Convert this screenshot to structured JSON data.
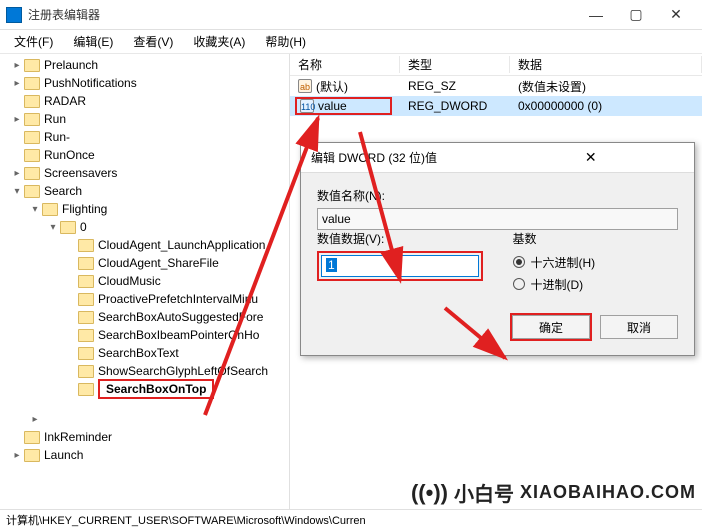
{
  "window": {
    "title": "注册表编辑器",
    "minimize": "—",
    "maximize": "▢",
    "close": "✕"
  },
  "menu": {
    "file": "文件(F)",
    "edit": "编辑(E)",
    "view": "查看(V)",
    "favorites": "收藏夹(A)",
    "help": "帮助(H)"
  },
  "tree": {
    "items": [
      "Prelaunch",
      "PushNotifications",
      "RADAR",
      "Run",
      "Run-",
      "RunOnce",
      "Screensavers",
      "Search",
      "Flighting",
      "0",
      "CloudAgent_LaunchApplication",
      "CloudAgent_ShareFile",
      "CloudMusic",
      "ProactivePrefetchIntervalMinu",
      "SearchBoxAutoSuggestedFore",
      "SearchBoxIbeamPointerOnHo",
      "SearchBoxText",
      "ShowSearchGlyphLeftOfSearch",
      "SearchBoxOnTop",
      "InkReminder",
      "Launch"
    ]
  },
  "list": {
    "col_name": "名称",
    "col_type": "类型",
    "col_data": "数据",
    "rows": [
      {
        "icon": "str",
        "name": "(默认)",
        "type": "REG_SZ",
        "data": "(数值未设置)"
      },
      {
        "icon": "bin",
        "name": "value",
        "type": "REG_DWORD",
        "data": "0x00000000 (0)"
      }
    ]
  },
  "dialog": {
    "title": "编辑 DWORD (32 位)值",
    "name_label": "数值名称(N):",
    "name_value": "value",
    "data_label": "数值数据(V):",
    "data_value": "1",
    "base_label": "基数",
    "radio_hex": "十六进制(H)",
    "radio_dec": "十进制(D)",
    "ok": "确定",
    "cancel": "取消",
    "close": "✕"
  },
  "statusbar": "计算机\\HKEY_CURRENT_USER\\SOFTWARE\\Microsoft\\Windows\\Curren",
  "brand": {
    "name": "小白号",
    "url": "XIAOBAIHAO.COM"
  }
}
